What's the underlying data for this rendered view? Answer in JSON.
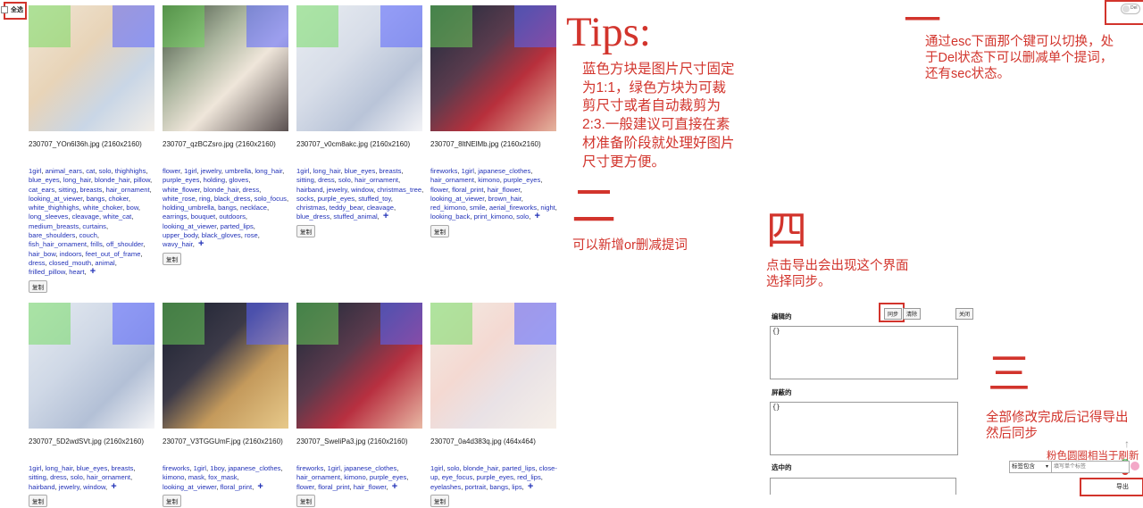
{
  "toolbar": {
    "select_all": "全选",
    "del_toggle": "Del"
  },
  "cards": [
    {
      "filename": "230707_YOn6l36h.jpg (2160x2160)",
      "tags": [
        "1girl",
        "animal_ears",
        "cat",
        "solo",
        "thighhighs",
        "blue_eyes",
        "long_hair",
        "blonde_hair",
        "pillow",
        "cat_ears",
        "sitting",
        "breasts",
        "hair_ornament",
        "looking_at_viewer",
        "bangs",
        "choker",
        "white_thighhighs",
        "white_choker",
        "bow",
        "long_sleeves",
        "cleavage",
        "white_cat",
        "medium_breasts",
        "curtains",
        "bare_shoulders",
        "couch",
        "fish_hair_ornament",
        "frills",
        "off_shoulder",
        "hair_bow",
        "indoors",
        "feet_out_of_frame",
        "dress",
        "closed_mouth",
        "animal",
        "frilled_pillow",
        "heart"
      ],
      "bg": "linear-gradient(135deg,#f0e6d6,#e8d4b8 40%,#c9d6e6 70%,#f2eee8)"
    },
    {
      "filename": "230707_qzBCZsro.jpg (2160x2160)",
      "tags": [
        "flower",
        "1girl",
        "jewelry",
        "umbrella",
        "long_hair",
        "purple_eyes",
        "holding",
        "gloves",
        "white_flower",
        "blonde_hair",
        "dress",
        "white_rose",
        "ring",
        "black_dress",
        "solo_focus",
        "holding_umbrella",
        "bangs",
        "necklace",
        "earrings",
        "bouquet",
        "outdoors",
        "looking_at_viewer",
        "parted_lips",
        "upper_body",
        "black_gloves",
        "rose",
        "wavy_hair"
      ],
      "bg": "linear-gradient(135deg,#3d4a3a,#a8b39c 35%,#efe6da 60%,#5a5050)"
    },
    {
      "filename": "230707_v0cm8akc.jpg (2160x2160)",
      "tags": [
        "1girl",
        "long_hair",
        "blue_eyes",
        "breasts",
        "sitting",
        "dress",
        "solo",
        "hair_ornament",
        "hairband",
        "jewelry",
        "window",
        "christmas_tree",
        "socks",
        "purple_eyes",
        "stuffed_toy",
        "christmas",
        "teddy_bear",
        "cleavage",
        "blue_dress",
        "stuffed_animal"
      ],
      "bg": "linear-gradient(135deg,#e9edf2,#d7dde8 40%,#b9c4d8 70%,#f3f3f6)"
    },
    {
      "filename": "230707_8ltNElMb.jpg (2160x2160)",
      "tags": [
        "fireworks",
        "1girl",
        "japanese_clothes",
        "hair_ornament",
        "kimono",
        "purple_eyes",
        "flower",
        "floral_print",
        "hair_flower",
        "looking_at_viewer",
        "brown_hair",
        "red_kimono",
        "smile",
        "aerial_fireworks",
        "night",
        "looking_back",
        "print_kimono",
        "solo"
      ],
      "bg": "linear-gradient(135deg,#1c2a3c,#5a3b4d 40%,#b8303c 65%,#e6b6a0)"
    },
    {
      "filename": "230707_5D2wdSVt.jpg (2160x2160)",
      "tags": [
        "1girl",
        "long_hair",
        "blue_eyes",
        "breasts",
        "sitting",
        "dress",
        "solo",
        "hair_ornament",
        "hairband",
        "jewelry",
        "window"
      ],
      "bg": "linear-gradient(135deg,#e6ebf1,#cfd8e6 40%,#b3c0d6 70%,#f5f5f7)"
    },
    {
      "filename": "230707_V3TGGUmF.jpg (2160x2160)",
      "tags": [
        "fireworks",
        "1girl",
        "1boy",
        "japanese_clothes",
        "kimono",
        "mask",
        "fox_mask",
        "looking_at_viewer",
        "floral_print"
      ],
      "bg": "linear-gradient(135deg,#1a2030,#3c3a48 40%,#c49a5c 65%,#e7c98a)"
    },
    {
      "filename": "230707_SweliPa3.jpg (2160x2160)",
      "tags": [
        "fireworks",
        "1girl",
        "japanese_clothes",
        "hair_ornament",
        "kimono",
        "purple_eyes",
        "flower",
        "floral_print",
        "hair_flower"
      ],
      "bg": "linear-gradient(135deg,#1a2838,#5a3a4c 40%,#b83040 65%,#e8b8a4)"
    },
    {
      "filename": "230707_0a4d383q.jpg (464x464)",
      "tags": [
        "1girl",
        "solo",
        "blonde_hair",
        "parted_lips",
        "close-up",
        "eye_focus",
        "purple_eyes",
        "red_lips",
        "eyelashes",
        "portrait",
        "bangs",
        "lips"
      ],
      "bg": "linear-gradient(135deg,#f1ece4,#f4d9d2 40%,#e9e2e6 65%,#f6efe8)"
    }
  ],
  "copy_label": "复制",
  "annotations": {
    "tips_title": "Tips:",
    "tips_body": "蓝色方块是图片尺寸固定为1:1，绿色方块为可裁剪尺寸或者自动裁剪为2:3.一般建议可直接在素材准备阶段就处理好图片尺寸更方便。",
    "one_mark": "一",
    "one_text": "通过esc下面那个键可以切换，处于Del状态下可以删减单个提词，还有sec状态。",
    "two_mark": "二",
    "two_text": "可以新增or删减提词",
    "four_mark": "四",
    "four_text": "点击导出会出现这个界面选择同步。",
    "three_mark": "三",
    "three_text": "全部修改完成后记得导出然后同步",
    "pink_text": "粉色圆圈相当于刷新"
  },
  "export_panel": {
    "edited_label": "编辑的",
    "sync_button": "同步",
    "clear_button": "清除",
    "close_button": "关闭",
    "edited_value": "{}",
    "blocked_label": "屏蔽的",
    "blocked_value": "{}",
    "selected_label": "选中的"
  },
  "bottom_bar": {
    "select_value": "标签包含",
    "input_placeholder": "填写单个标签",
    "export_button": "导出",
    "badge_green": "0",
    "badge_red": "0",
    "up_arrow": "↑"
  },
  "colors": {
    "accent_red": "#d2342c",
    "tag_blue": "#2333b8"
  }
}
